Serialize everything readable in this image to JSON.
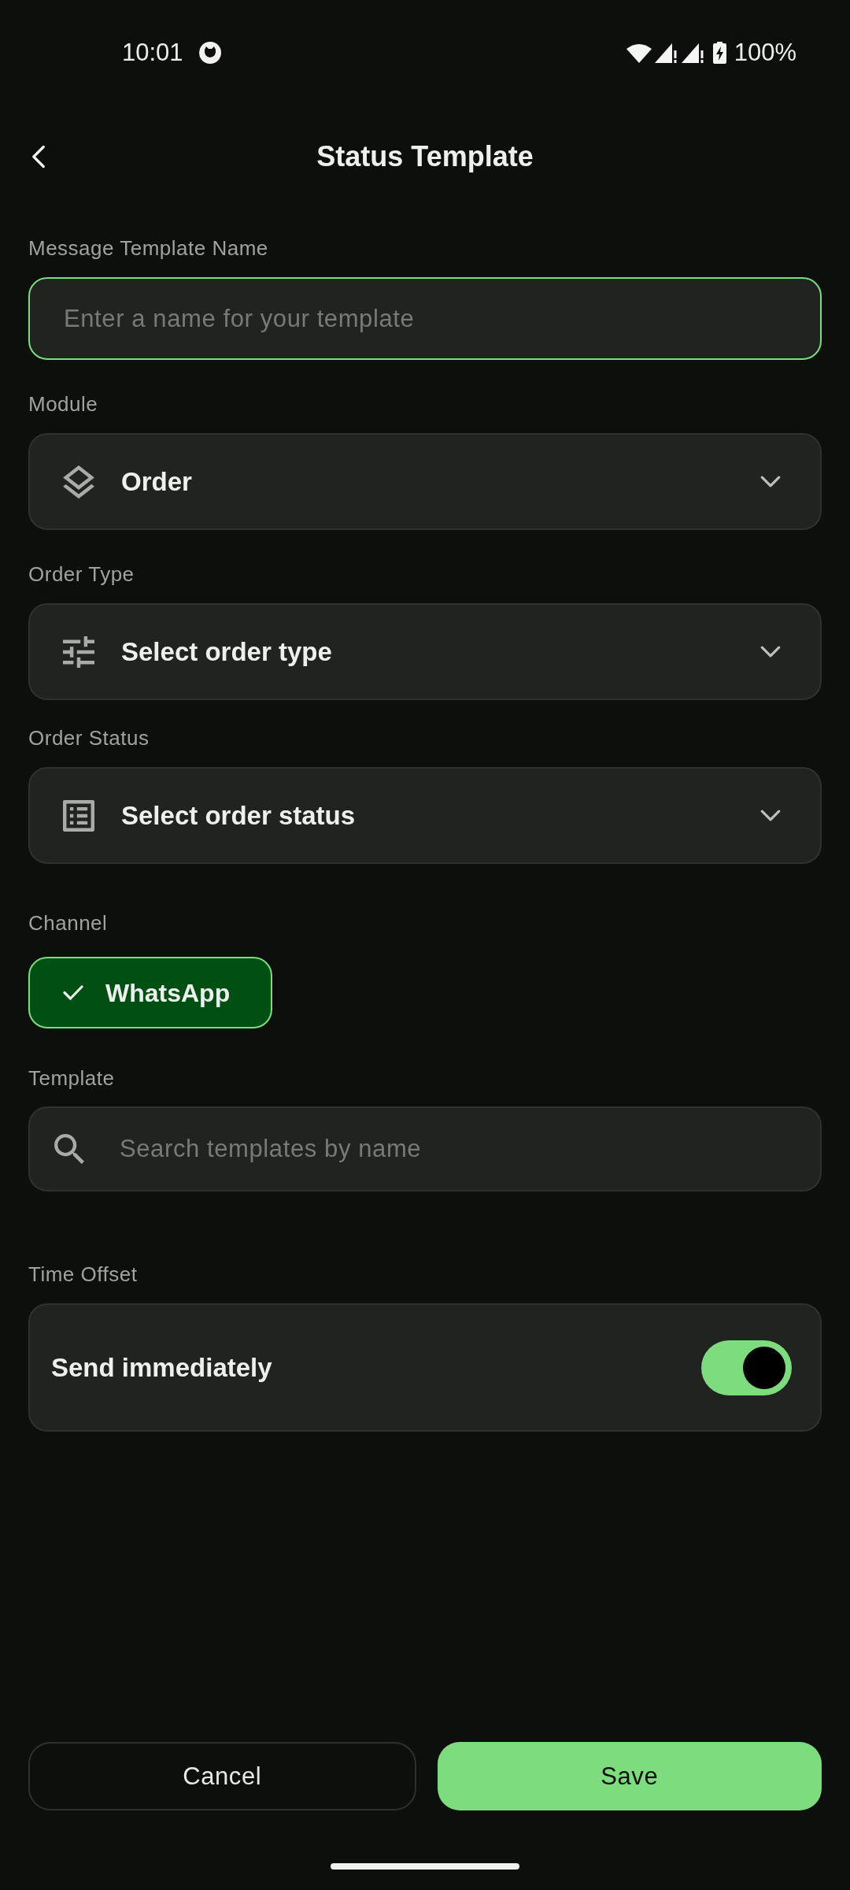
{
  "status_bar": {
    "time": "10:01",
    "battery": "100%"
  },
  "header": {
    "title": "Status Template"
  },
  "name_field": {
    "label": "Message Template Name",
    "placeholder": "Enter a name for your template",
    "focused": true
  },
  "selects": [
    {
      "label": "Module",
      "text": "Order",
      "kind": "layers"
    },
    {
      "label": "Order Type",
      "text": "Select order type",
      "kind": "tune"
    },
    {
      "label": "Order Status",
      "text": "Select order status",
      "kind": "list"
    }
  ],
  "channel": {
    "label": "Channel",
    "options": [
      {
        "label": "WhatsApp",
        "selected": true
      }
    ]
  },
  "template_search": {
    "label": "Template",
    "placeholder": "Search templates by name"
  },
  "time_offset": {
    "label": "Time Offset",
    "text": "Send immediately",
    "on": true
  },
  "buttons": [
    {
      "label": "Cancel",
      "kind": "secondary"
    },
    {
      "label": "Save",
      "kind": "primary"
    }
  ]
}
